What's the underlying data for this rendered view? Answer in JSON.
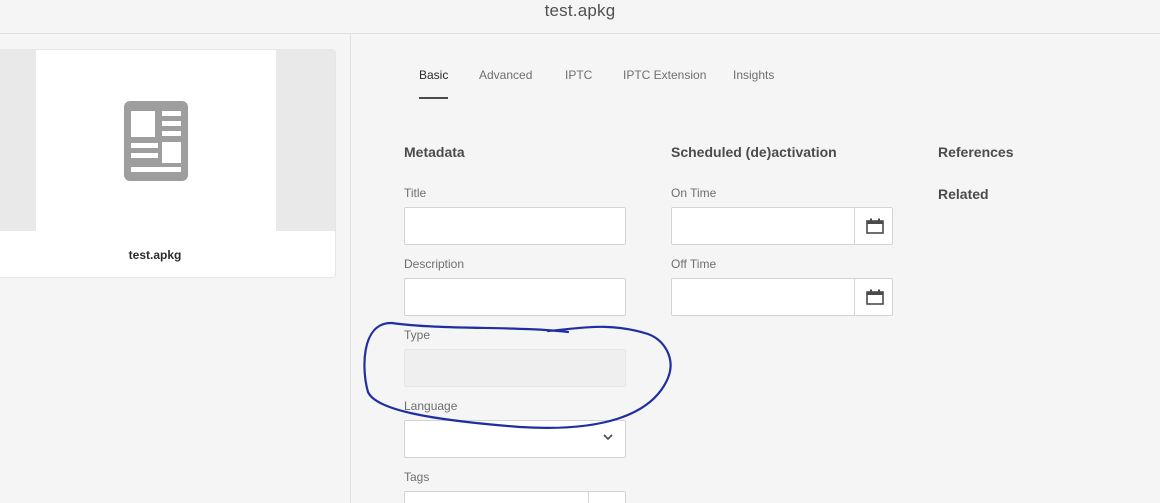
{
  "header": {
    "title": "test.apkg"
  },
  "asset_card": {
    "name": "test.apkg",
    "thumbnail_icon": "document-icon"
  },
  "tabs": [
    {
      "label": "Basic",
      "active": true
    },
    {
      "label": "Advanced",
      "active": false
    },
    {
      "label": "IPTC",
      "active": false
    },
    {
      "label": "IPTC Extension",
      "active": false
    },
    {
      "label": "Insights",
      "active": false
    }
  ],
  "metadata": {
    "heading": "Metadata",
    "title": {
      "label": "Title",
      "value": ""
    },
    "description": {
      "label": "Description",
      "value": ""
    },
    "type": {
      "label": "Type",
      "value": ""
    },
    "language": {
      "label": "Language",
      "value": ""
    },
    "tags": {
      "label": "Tags",
      "value": ""
    }
  },
  "scheduled": {
    "heading": "Scheduled (de)activation",
    "on_time": {
      "label": "On Time",
      "value": ""
    },
    "off_time": {
      "label": "Off Time",
      "value": ""
    }
  },
  "references": {
    "heading": "References",
    "related": "Related"
  },
  "colors": {
    "annotation": "#1f2fa0",
    "background": "#f5f5f5"
  }
}
